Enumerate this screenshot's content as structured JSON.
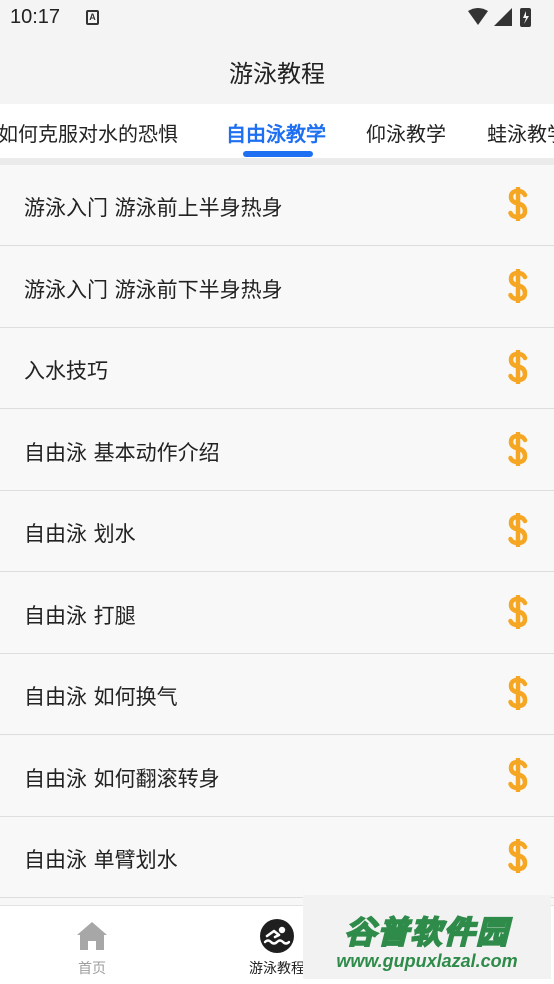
{
  "status_bar": {
    "time": "10:17",
    "notification_letter": "A"
  },
  "header": {
    "title": "游泳教程"
  },
  "tabs": [
    {
      "label": "如何克服对水的恐惧",
      "active": false
    },
    {
      "label": "自由泳教学",
      "active": true
    },
    {
      "label": "仰泳教学",
      "active": false
    },
    {
      "label": "蛙泳教学",
      "active": false
    }
  ],
  "lessons": [
    {
      "title": "游泳入门 游泳前上半身热身"
    },
    {
      "title": "游泳入门 游泳前下半身热身"
    },
    {
      "title": "入水技巧"
    },
    {
      "title": "自由泳 基本动作介绍"
    },
    {
      "title": "自由泳 划水"
    },
    {
      "title": "自由泳 打腿"
    },
    {
      "title": "自由泳 如何换气"
    },
    {
      "title": "自由泳 如何翻滚转身"
    },
    {
      "title": "自由泳 单臂划水"
    }
  ],
  "lesson_icon": "paid-coin-icon",
  "bottom_nav": [
    {
      "label": "首页",
      "icon": "home-icon",
      "active": false
    },
    {
      "label": "游泳教程",
      "icon": "swimmer-icon",
      "active": true
    }
  ],
  "watermark": {
    "name": "谷普软件园",
    "url": "www.gupuxlazal.com"
  },
  "colors": {
    "accent": "#1e6ff1",
    "coin": "#f5a623",
    "inactive_nav": "#9e9e9e",
    "watermark_green": "#2e8b4a"
  }
}
